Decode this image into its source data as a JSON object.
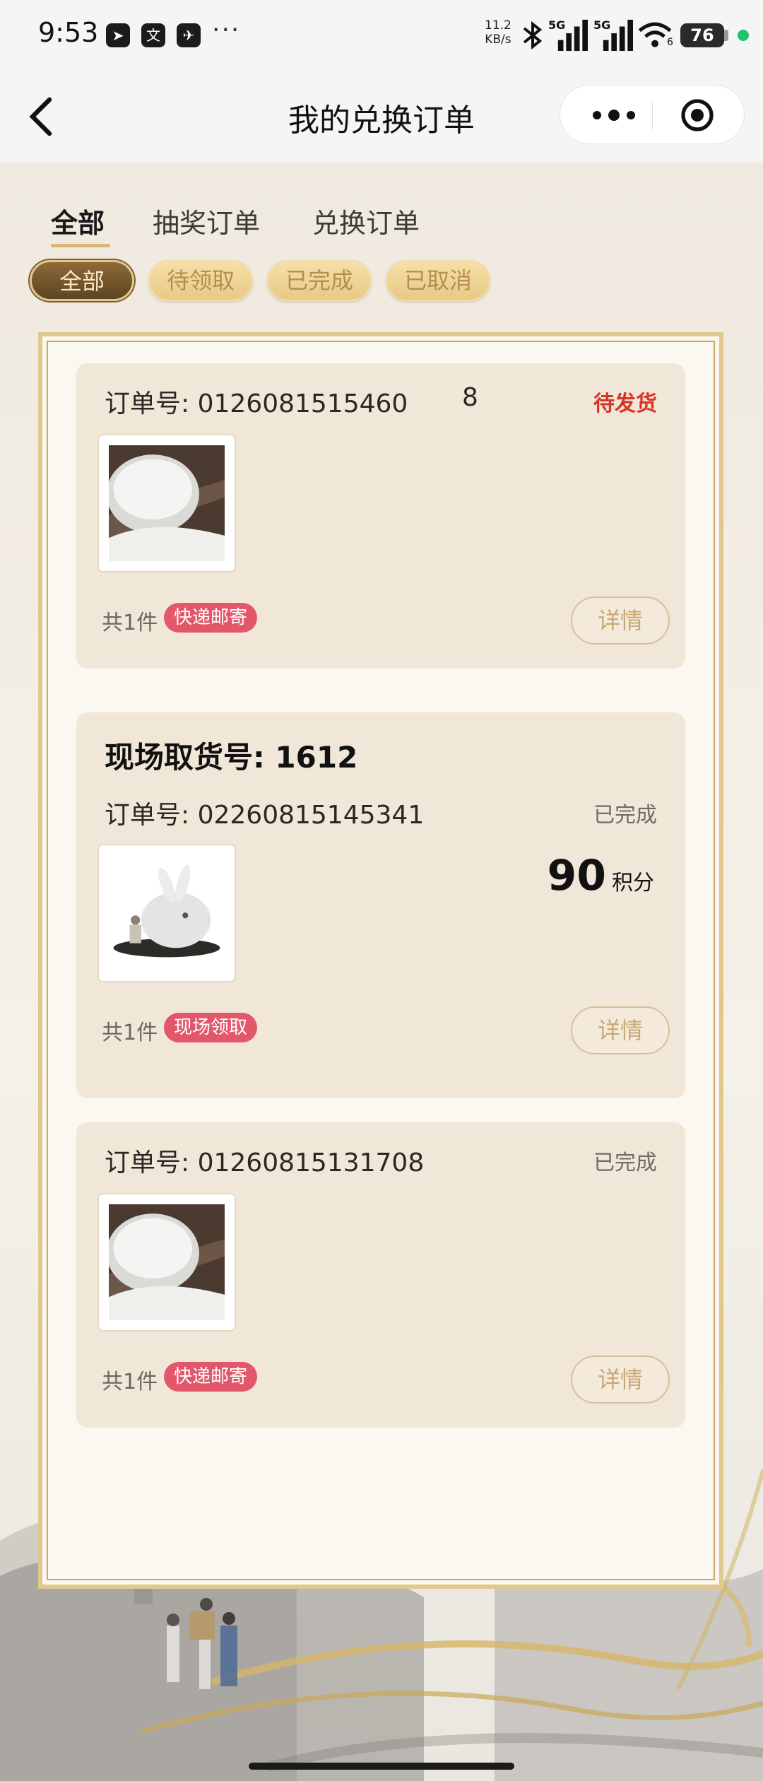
{
  "status_bar": {
    "time": "9:53",
    "more": "···",
    "net_speed_value": "11.2",
    "net_speed_unit": "KB/s",
    "signal_1": "5G",
    "signal_2": "5G",
    "wifi_label": "6",
    "battery": "76",
    "app_icons": [
      "location-arrow-icon",
      "translate-icon",
      "send-icon"
    ]
  },
  "nav": {
    "title": "我的兑换订单"
  },
  "tabs": [
    {
      "label": "全部",
      "active": true
    },
    {
      "label": "抽奖订单",
      "active": false
    },
    {
      "label": "兑换订单",
      "active": false
    }
  ],
  "filters": [
    {
      "label": "全部",
      "active": true
    },
    {
      "label": "待领取",
      "active": false
    },
    {
      "label": "已完成",
      "active": false
    },
    {
      "label": "已取消",
      "active": false
    }
  ],
  "orders": [
    {
      "order_label": "订单号: 0126081515460",
      "order_tail": "8",
      "status": "待发货",
      "product": "rice",
      "quantity": "共1件",
      "delivery": "快递邮寄",
      "detail": "详情"
    },
    {
      "pickup": "现场取货号: 1612",
      "order_label": "订单号: 02260815145341",
      "status": "已完成",
      "product": "rabbit-figurine",
      "points_value": "90",
      "points_unit": "积分",
      "quantity": "共1件",
      "delivery": "现场领取",
      "detail": "详情"
    },
    {
      "order_label": "订单号: 01260815131708",
      "status": "已完成",
      "product": "rice",
      "quantity": "共1件",
      "delivery": "快递邮寄",
      "detail": "详情"
    }
  ],
  "colors": {
    "accent_gold": "#d9b772",
    "status_pending": "#d8352a",
    "badge_red": "#e3576a",
    "card_bg": "#f1e7d8",
    "panel_bg": "#fbf7f1"
  }
}
